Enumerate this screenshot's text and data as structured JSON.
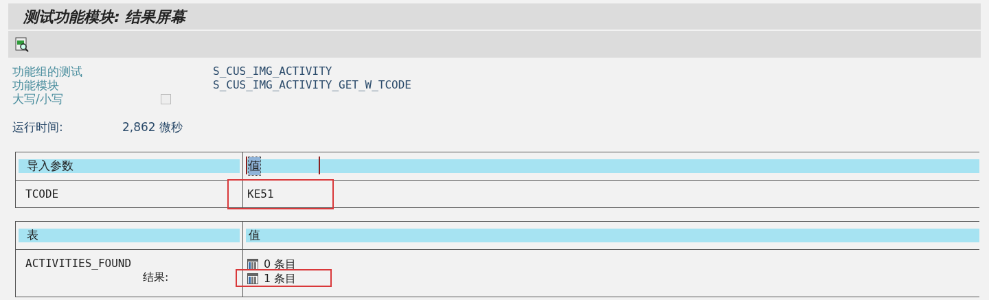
{
  "title": "测试功能模块: 结果屏幕",
  "fields": [
    {
      "kind": "text",
      "label": "功能组的测试",
      "value": "S_CUS_IMG_ACTIVITY"
    },
    {
      "kind": "text",
      "label": "功能模块",
      "value": "S_CUS_IMG_ACTIVITY_GET_W_TCODE"
    },
    {
      "kind": "checkbox",
      "label": "大写/小写",
      "checked": false
    }
  ],
  "runtime": {
    "label": "运行时间:",
    "value": "2,862 微秒"
  },
  "import_table": {
    "columns": [
      {
        "label": "导入参数",
        "focused": false
      },
      {
        "label": "值",
        "focused": true
      }
    ],
    "rows": [
      {
        "name": "TCODE",
        "value": "KE51",
        "highlighted": true
      }
    ]
  },
  "tables_table": {
    "columns": [
      {
        "label": "表",
        "focused": false
      },
      {
        "label": "值",
        "focused": false
      }
    ],
    "rows": [
      {
        "name": "ACTIVITIES_FOUND",
        "sub_label": "结果:",
        "entries": [
          {
            "text": "0 条目",
            "highlighted": false
          },
          {
            "text": "1 条目",
            "highlighted": true
          }
        ]
      }
    ]
  }
}
